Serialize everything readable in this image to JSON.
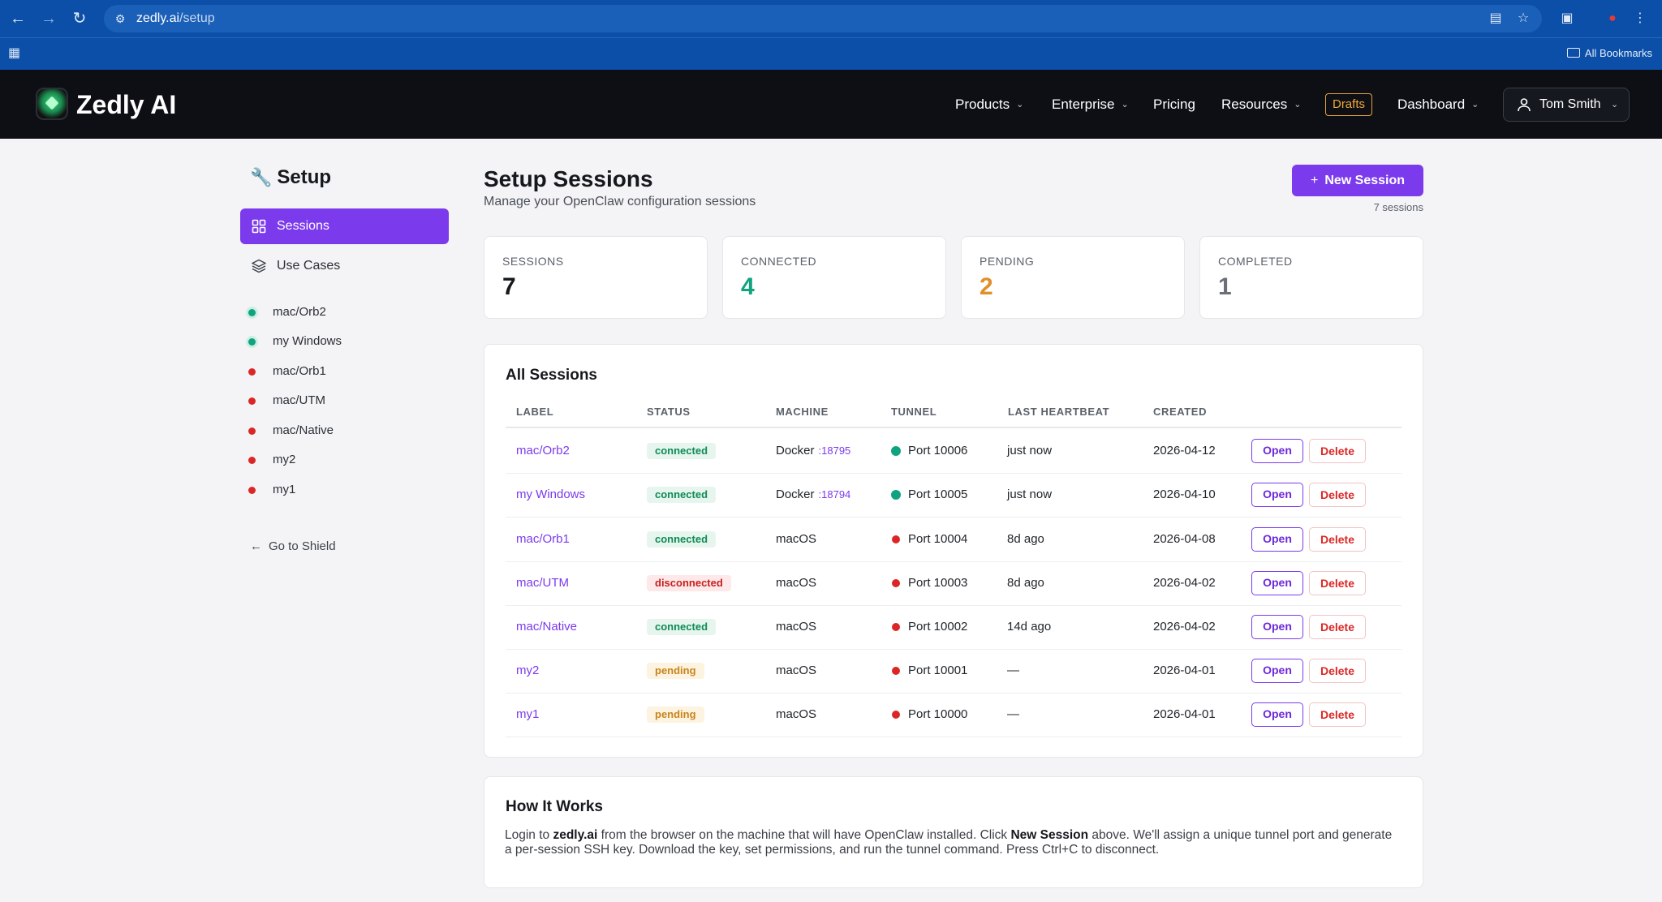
{
  "browser": {
    "url_host": "zedly.ai",
    "url_path": "/setup",
    "bookmarks_label": "All Bookmarks"
  },
  "header": {
    "brand": "Zedly AI",
    "nav": [
      "Products",
      "Enterprise",
      "Pricing",
      "Resources",
      "Drafts",
      "Dashboard"
    ],
    "user_name": "Tom Smith"
  },
  "sidebar": {
    "title": "Setup",
    "items": [
      "Sessions",
      "Use Cases"
    ],
    "sessions": [
      {
        "label": "mac/Orb2",
        "status": "green"
      },
      {
        "label": "my Windows",
        "status": "green"
      },
      {
        "label": "mac/Orb1",
        "status": "red"
      },
      {
        "label": "mac/UTM",
        "status": "red"
      },
      {
        "label": "mac/Native",
        "status": "red"
      },
      {
        "label": "my2",
        "status": "red"
      },
      {
        "label": "my1",
        "status": "red"
      }
    ],
    "back_link": "Go to Shield"
  },
  "main": {
    "title": "Setup Sessions",
    "subtitle": "Manage your OpenClaw configuration sessions",
    "new_button": "New Session",
    "session_count": "7 sessions",
    "stats": [
      {
        "label": "SESSIONS",
        "value": "7",
        "color": "#15181c"
      },
      {
        "label": "CONNECTED",
        "value": "4",
        "color": "#10a37f"
      },
      {
        "label": "PENDING",
        "value": "2",
        "color": "#e0902a"
      },
      {
        "label": "COMPLETED",
        "value": "1",
        "color": "#6b7078"
      }
    ]
  },
  "table": {
    "title": "All Sessions",
    "headers": [
      "LABEL",
      "STATUS",
      "MACHINE",
      "TUNNEL",
      "LAST HEARTBEAT",
      "CREATED"
    ],
    "open_label": "Open",
    "delete_label": "Delete",
    "rows": [
      {
        "label": "mac/Orb2",
        "status": "connected",
        "machine": "Docker",
        "machine_port": ":18795",
        "tunnel_state": "green",
        "tunnel": "Port 10006",
        "heartbeat": "just now",
        "created": "2026-04-12"
      },
      {
        "label": "my Windows",
        "status": "connected",
        "machine": "Docker",
        "machine_port": ":18794",
        "tunnel_state": "green",
        "tunnel": "Port 10005",
        "heartbeat": "just now",
        "created": "2026-04-10"
      },
      {
        "label": "mac/Orb1",
        "status": "connected",
        "machine": "macOS",
        "machine_port": "",
        "tunnel_state": "red",
        "tunnel": "Port 10004",
        "heartbeat": "8d ago",
        "created": "2026-04-08"
      },
      {
        "label": "mac/UTM",
        "status": "disconnected",
        "machine": "macOS",
        "machine_port": "",
        "tunnel_state": "red",
        "tunnel": "Port 10003",
        "heartbeat": "8d ago",
        "created": "2026-04-02"
      },
      {
        "label": "mac/Native",
        "status": "connected",
        "machine": "macOS",
        "machine_port": "",
        "tunnel_state": "red",
        "tunnel": "Port 10002",
        "heartbeat": "14d ago",
        "created": "2026-04-02"
      },
      {
        "label": "my2",
        "status": "pending",
        "machine": "macOS",
        "machine_port": "",
        "tunnel_state": "red",
        "tunnel": "Port 10001",
        "heartbeat": "—",
        "created": "2026-04-01"
      },
      {
        "label": "my1",
        "status": "pending",
        "machine": "macOS",
        "machine_port": "",
        "tunnel_state": "red",
        "tunnel": "Port 10000",
        "heartbeat": "—",
        "created": "2026-04-01"
      }
    ]
  },
  "how": {
    "title": "How It Works",
    "p1": "Login to ",
    "p1_bold": "zedly.ai",
    "p2": " from the browser on the machine that will have OpenClaw installed. Click ",
    "p2_bold": "New Session",
    "p3": " above. We'll assign a unique tunnel port and generate a per-session SSH key. Download the key, set permissions, and run the tunnel command. Press Ctrl+C to disconnect."
  }
}
